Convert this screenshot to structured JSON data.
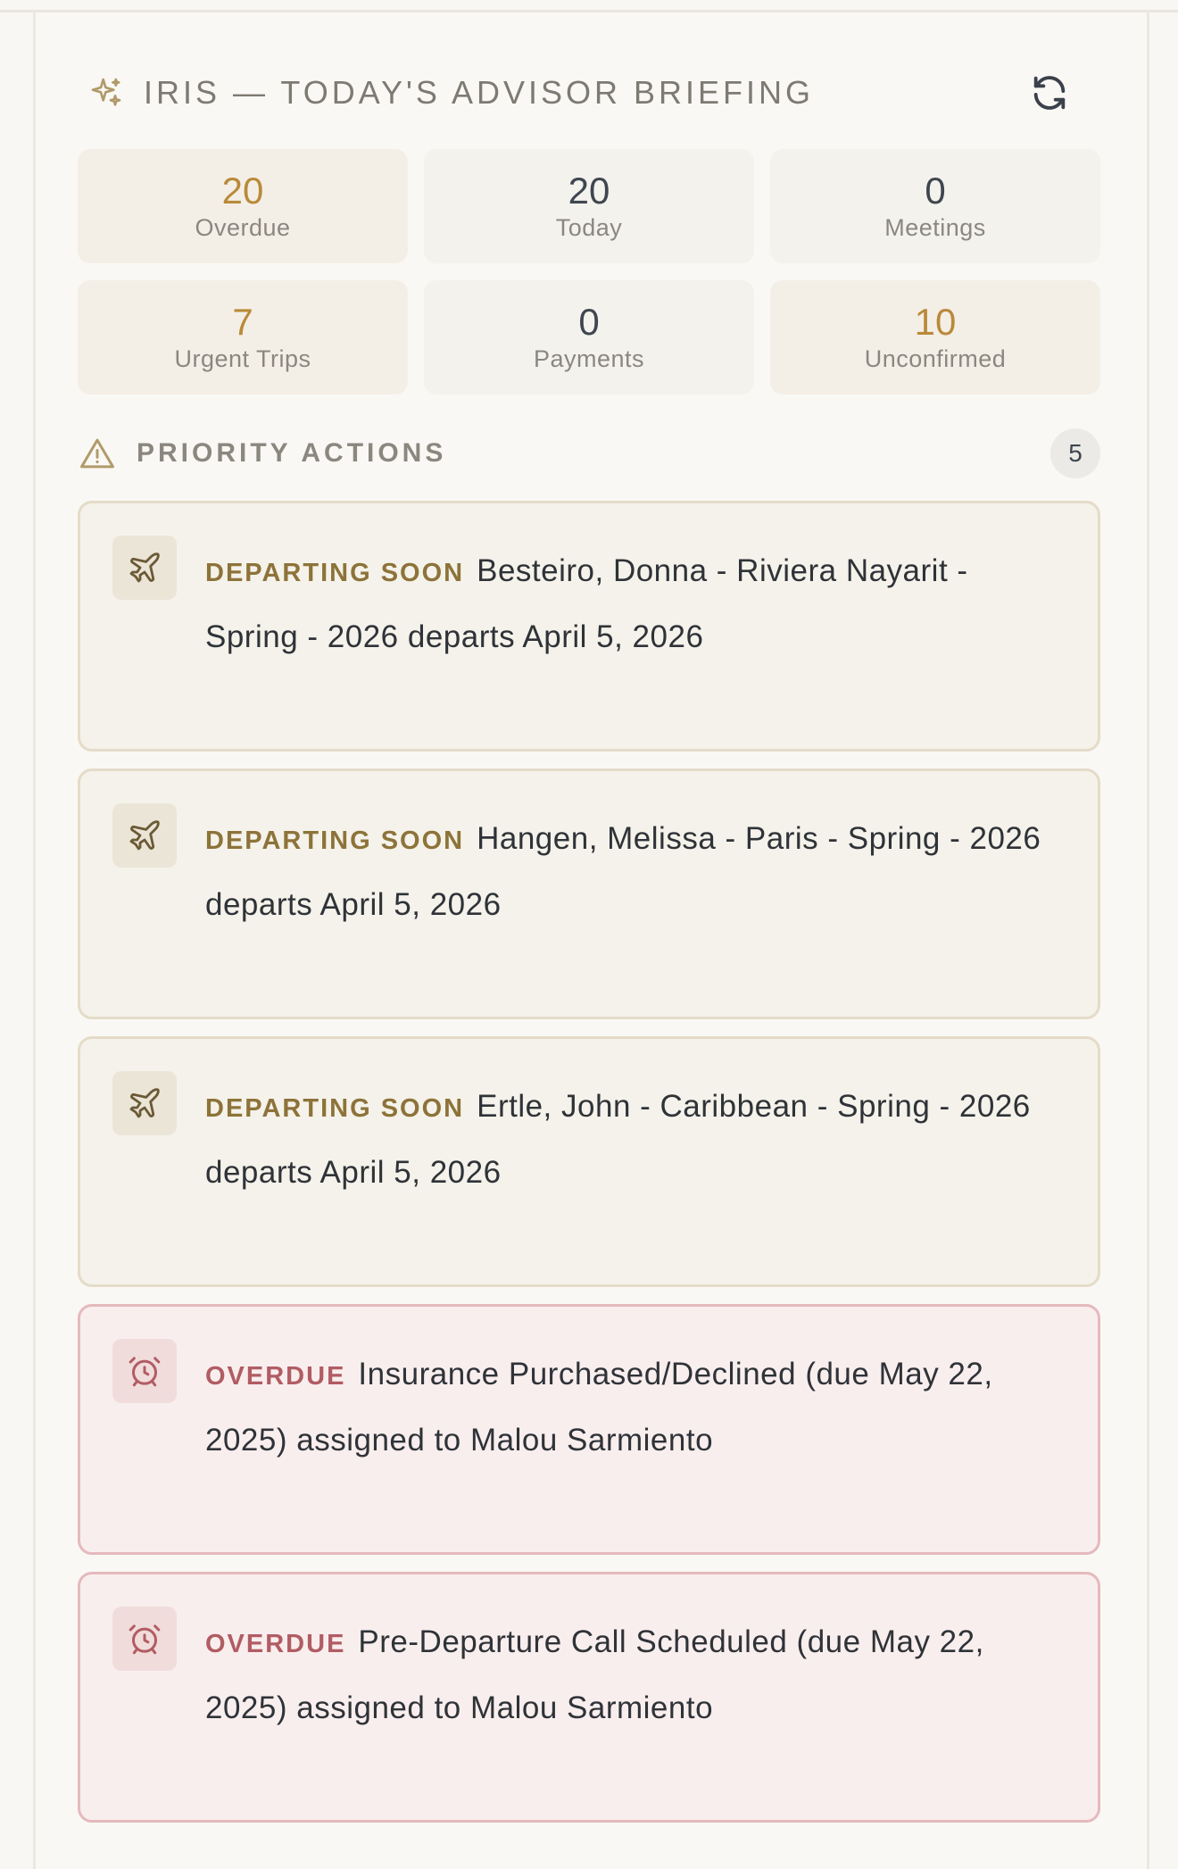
{
  "briefing": {
    "title": "IRIS — TODAY'S ADVISOR BRIEFING",
    "icon": "sparkle-icon",
    "refresh_icon": "refresh-icon"
  },
  "stats": [
    {
      "value": "20",
      "label": "Overdue"
    },
    {
      "value": "20",
      "label": "Today"
    },
    {
      "value": "0",
      "label": "Meetings"
    },
    {
      "value": "7",
      "label": "Urgent Trips"
    },
    {
      "value": "0",
      "label": "Payments"
    },
    {
      "value": "10",
      "label": "Unconfirmed"
    }
  ],
  "priority_actions": {
    "title": "PRIORITY ACTIONS",
    "count": "5",
    "items": [
      {
        "type": "departing",
        "tag": "DEPARTING SOON",
        "text": "Besteiro, Donna - Riviera Nayarit - Spring - 2026 departs April 5, 2026",
        "icon": "plane-icon"
      },
      {
        "type": "departing",
        "tag": "DEPARTING SOON",
        "text": "Hangen, Melissa - Paris - Spring - 2026 departs April 5, 2026",
        "icon": "plane-icon"
      },
      {
        "type": "departing",
        "tag": "DEPARTING SOON",
        "text": "Ertle, John - Caribbean - Spring - 2026 departs April 5, 2026",
        "icon": "plane-icon"
      },
      {
        "type": "overdue",
        "tag": "OVERDUE",
        "text": "Insurance Purchased/Declined (due May 22, 2025) assigned to Malou Sarmiento",
        "icon": "alarm-clock-icon"
      },
      {
        "type": "overdue",
        "tag": "OVERDUE",
        "text": "Pre-Departure Call Scheduled (due May 22, 2025) assigned to Malou Sarmiento",
        "icon": "alarm-clock-icon"
      }
    ]
  },
  "colors": {
    "accent_gold": "#b98a3a",
    "departing_tag": "#8d7339",
    "overdue_tag": "#b15c63",
    "overdue_border": "#e5b9bd",
    "departing_border": "#e4dcc8"
  }
}
